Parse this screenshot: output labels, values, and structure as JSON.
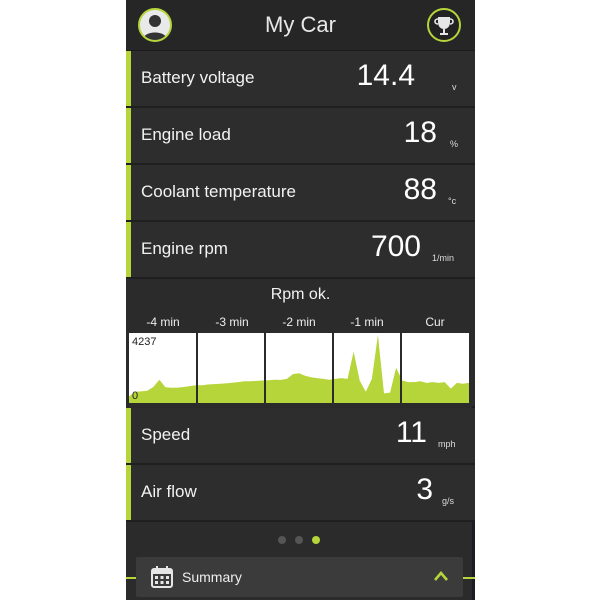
{
  "header": {
    "title": "My Car",
    "profile_icon": "user-icon",
    "trophy_icon": "trophy-icon"
  },
  "metrics_top": [
    {
      "label": "Battery voltage",
      "value": "14.4",
      "unit": "v"
    },
    {
      "label": "Engine load",
      "value": "18",
      "unit": "%"
    },
    {
      "label": "Coolant temperature",
      "value": "88",
      "unit": "°c"
    },
    {
      "label": "Engine rpm",
      "value": "700",
      "unit": "1/min"
    }
  ],
  "rpm_chart": {
    "status": "Rpm ok.",
    "time_labels": [
      "-4 min",
      "-3 min",
      "-2 min",
      "-1 min",
      "Cur"
    ],
    "y_max_label": "4237",
    "y_min_label": "0",
    "chart_data": {
      "type": "area",
      "ylim": [
        0,
        4237
      ],
      "x_categories": [
        "-4 min",
        "-3 min",
        "-2 min",
        "-1 min",
        "Cur"
      ],
      "values": [
        400,
        700,
        720,
        760,
        1000,
        1450,
        980,
        950,
        960,
        1000,
        1050,
        1100,
        1100,
        1150,
        1180,
        1200,
        1220,
        1260,
        1300,
        1350,
        1360,
        1380,
        1400,
        1420,
        1450,
        1440,
        1500,
        1800,
        1850,
        1700,
        1600,
        1550,
        1500,
        1450,
        1500,
        1550,
        1500,
        3200,
        1400,
        700,
        1500,
        4237,
        600,
        650,
        2200,
        1400,
        1300,
        1300,
        1350,
        1250,
        1300,
        1250,
        1300,
        900,
        1250,
        1200,
        1250
      ]
    }
  },
  "metrics_bottom": [
    {
      "label": "Speed",
      "value": "11",
      "unit": "mph"
    },
    {
      "label": "Air flow",
      "value": "3",
      "unit": "g/s"
    }
  ],
  "pager": {
    "count": 3,
    "active": 3
  },
  "summary": {
    "label": "Summary",
    "icon": "calendar-icon",
    "toggle_icon": "chevron-up-icon"
  },
  "colors": {
    "accent": "#b5d53a",
    "background": "#2b2b2b",
    "chart_fill": "#b5d53a"
  }
}
